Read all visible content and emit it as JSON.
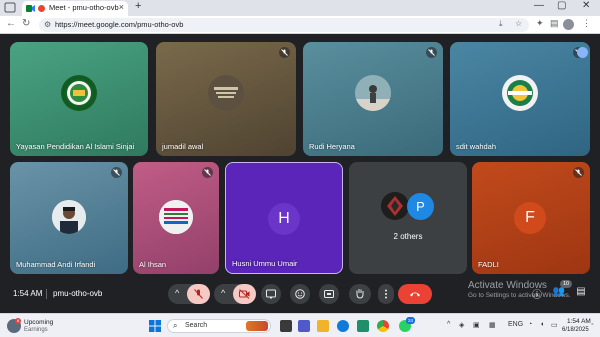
{
  "browser": {
    "tab_title": "Meet - pmu-otho-ovb",
    "tab_close": "×",
    "new_tab": "+",
    "url": "https://meet.google.com/pmu-otho-ovb"
  },
  "tiles": [
    {
      "id": "yayasan",
      "name": "Yayasan Pendidikan Al Islami Sinjai",
      "muted": false,
      "bg": "#3a8a6a"
    },
    {
      "id": "jumadil",
      "name": "jumadil awal",
      "muted": true,
      "bg": "#6b5a3f"
    },
    {
      "id": "rudi",
      "name": "Rudi Heryana",
      "muted": true,
      "bg": "#4d7a8a"
    },
    {
      "id": "sdit",
      "name": "sdit wahdah",
      "muted": true,
      "bg": "#3f6f8a"
    },
    {
      "id": "muhammad",
      "name": "Muhammad Andi Irfandi",
      "muted": true,
      "bg": "#4f7890"
    },
    {
      "id": "alihsan",
      "name": "Al Ihsan",
      "muted": true,
      "bg": "#b0507a"
    },
    {
      "id": "husni",
      "name": "Husni Ummu Umair",
      "muted": false,
      "bg": "#5a25b8",
      "initial": "H",
      "initial_bg": "#6a35c8"
    },
    {
      "id": "others",
      "name": "2 others",
      "muted": false,
      "bg": "#3c4043",
      "initial": "P",
      "initial_bg": "#1e88e5"
    },
    {
      "id": "fadli",
      "name": "FADLI",
      "muted": true,
      "bg": "#b5421a",
      "initial": "F",
      "initial_bg": "#d04a1c"
    }
  ],
  "meeting": {
    "time": "1:54 AM",
    "code": "pmu-otho-ovb"
  },
  "controls": {
    "mic_menu": "^",
    "cam_menu": "^",
    "participant_badge": "10"
  },
  "watermark": {
    "line1": "Activate Windows",
    "line2": "Go to Settings to activate Windows."
  },
  "taskbar": {
    "weather_title": "Upcoming",
    "weather_sub": "Earnings",
    "weather_badge": "8",
    "search": "Search",
    "whatsapp_badge": "24",
    "lang": "ENG",
    "time": "1:54 AM",
    "date": "6/18/2025"
  },
  "colors": {
    "meet_bg": "#202124",
    "end_call": "#ea4335",
    "muted_btn": "#f6c9c4",
    "ctrl_btn": "#3c4043"
  }
}
